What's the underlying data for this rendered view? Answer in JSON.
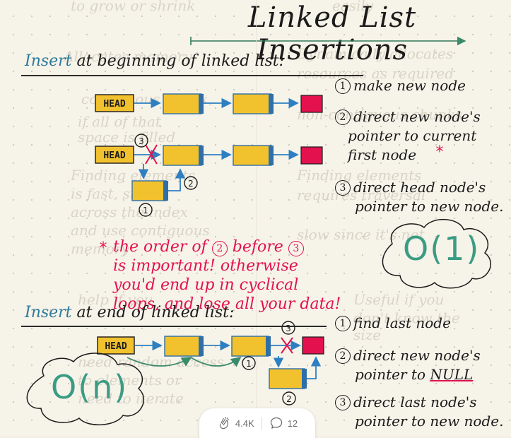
{
  "page": {
    "title": "Linked List Insertions"
  },
  "ghost_text": [
    "to grow or shrink",
    "easily",
    "Allocates memory",
    "contiguous chunk,",
    "if all of that",
    "space is filled",
    "Finding elements",
    "is fast, since",
    "across the index",
    "and use contiguous",
    "memory",
    "Dynamically allocates",
    "resources as required",
    "non-contiguous chunks",
    "Finding elements",
    "requires traversal",
    "slow since it's not",
    "Useful if you",
    "don't know the",
    "size",
    "help if you",
    "need random access",
    "to elements or",
    "need to iterate"
  ],
  "section_beginning": {
    "heading_keyword": "Insert",
    "heading_rest": "at beginning of linked list:",
    "steps": [
      {
        "num": "1",
        "text": "make new node"
      },
      {
        "num": "2",
        "line1": "direct new node's",
        "line2": "pointer to current",
        "line3": "first node"
      },
      {
        "num": "3",
        "line1": "direct head node's",
        "line2": "pointer to new node."
      }
    ],
    "note": {
      "line1": "the order of",
      "num_a": "2",
      "mid": "before",
      "num_b": "3",
      "line2": "is important! otherwise",
      "line3": "you'd end up in cyclical",
      "line4": "loops, and lose all your data!"
    },
    "complexity": "O(1)"
  },
  "section_end": {
    "heading_keyword": "Insert",
    "heading_rest": "at end of linked list:",
    "steps": [
      {
        "num": "1",
        "text": "find last node"
      },
      {
        "num": "2",
        "line1": "direct new node's",
        "line2_prefix": "pointer to",
        "line2_null": "NULL"
      },
      {
        "num": "3",
        "line1": "direct last node's",
        "line2": "pointer to new node."
      }
    ],
    "complexity": "O(n)"
  },
  "diagram": {
    "head_label": "HEAD",
    "marker_1": "1",
    "marker_2": "2",
    "marker_3": "3"
  },
  "reactions": {
    "claps": "4.4K",
    "comments": "12",
    "clap_icon": "clap-icon",
    "comment_icon": "comment-icon"
  },
  "colors": {
    "node_fill": "#f2c12e",
    "node_edge": "#2e6fa8",
    "head_fill": "#f2c12e",
    "null_fill": "#e3124f",
    "arrow": "#2e7fc2",
    "pink": "#e3124f",
    "teal": "#3a9c84"
  }
}
